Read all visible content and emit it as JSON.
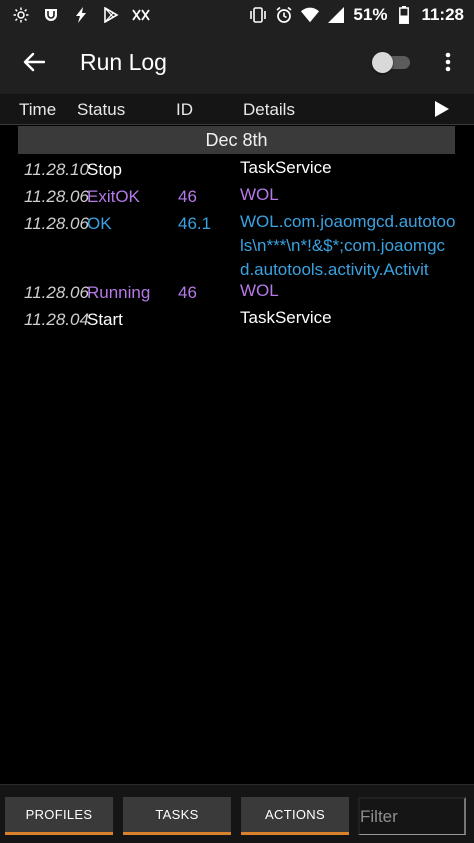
{
  "status_bar": {
    "left_icons": [
      "brightness-icon",
      "shield-icon",
      "bolt-icon",
      "play-store-icon",
      "link-icon"
    ],
    "right_icons": [
      "vibrate-icon",
      "alarm-icon",
      "wifi-icon",
      "signal-icon",
      "battery-icon"
    ],
    "battery": "51%",
    "time": "11:28"
  },
  "app_bar": {
    "title": "Run Log",
    "toggle_on": false
  },
  "columns": {
    "time": "Time",
    "status": "Status",
    "id": "ID",
    "details": "Details"
  },
  "date_group": "Dec 8th",
  "log": [
    {
      "time": "11.28.10",
      "status": "Stop",
      "id": "",
      "details": "TaskService",
      "status_color": "#ffffff",
      "details_color": "#ffffff"
    },
    {
      "time": "11.28.06",
      "status": "ExitOK",
      "id": "46",
      "details": "WOL",
      "status_color": "#b579e8",
      "details_color": "#b579e8"
    },
    {
      "time": "11.28.06",
      "status": "OK",
      "id": "46.1",
      "details": "WOL.com.joaomgcd.autotools\\n***\\n*!&$*;com.joaomgcd.autotools.activity.Activit",
      "status_color": "#3aa2e0",
      "details_color": "#3aa2e0"
    },
    {
      "time": "11.28.06",
      "status": "Running",
      "id": "46",
      "details": "WOL",
      "status_color": "#b579e8",
      "details_color": "#b579e8"
    },
    {
      "time": "11.28.04",
      "status": "Start",
      "id": "",
      "details": "TaskService",
      "status_color": "#ffffff",
      "details_color": "#ffffff"
    }
  ],
  "bottom_bar": {
    "profiles": "PROFILES",
    "tasks": "TASKS",
    "actions": "ACTIONS",
    "filter_placeholder": "Filter",
    "accent": "#d9822b"
  }
}
